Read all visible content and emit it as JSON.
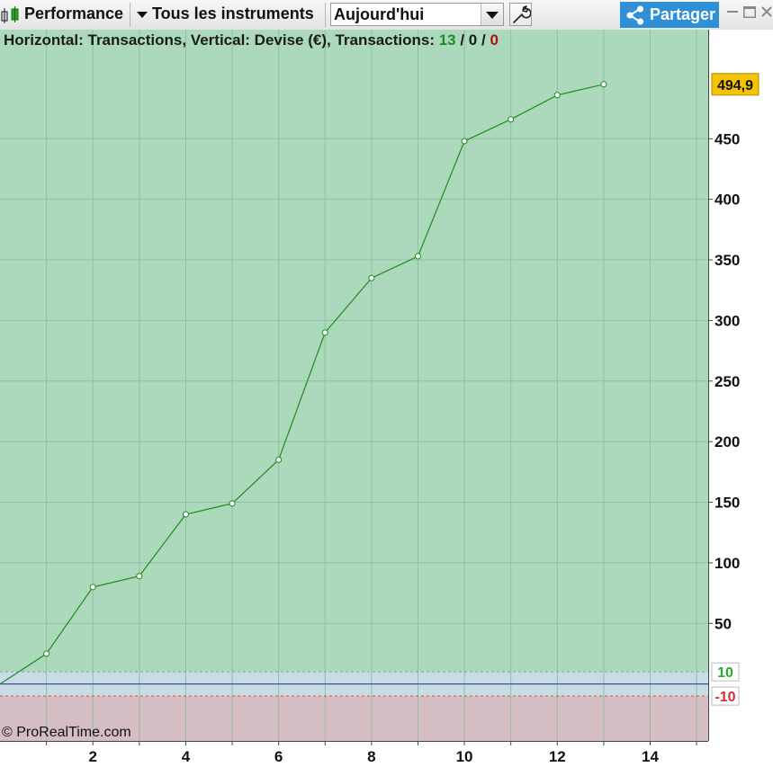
{
  "toolbar": {
    "app_label": "Performance",
    "instruments_label": "Tous les instruments",
    "period_value": "Aujourd'hui",
    "share_label": "Partager"
  },
  "chart_header": {
    "prefix": "Horizontal: Transactions, Vertical: Devise (€), Transactions: ",
    "wins": "13",
    "sep1": " / ",
    "neutral": "0",
    "sep2": " / ",
    "losses": "0"
  },
  "copyright": "© ProRealTime.com",
  "colors": {
    "profit_zone": "#acd9bb",
    "neutral_zone": "#c9dce6",
    "loss_zone": "#d4bdc3",
    "line": "#1e8c1e",
    "last_value_bg": "#f5c400",
    "upper_label": "#2ea82e",
    "lower_label": "#d23030"
  },
  "chart_data": {
    "type": "line",
    "title": "",
    "xlabel": "Transactions",
    "ylabel": "Devise (€)",
    "x": [
      0,
      1,
      2,
      3,
      4,
      5,
      6,
      7,
      8,
      9,
      10,
      11,
      12,
      13
    ],
    "series": [
      {
        "values": [
          0,
          25,
          80,
          89,
          140,
          149,
          185,
          290,
          335,
          353,
          448,
          466,
          486,
          494.9
        ]
      }
    ],
    "last_value_label": "494,9",
    "xticks": [
      2,
      4,
      6,
      8,
      10,
      12,
      14
    ],
    "yticks": [
      50,
      100,
      150,
      200,
      250,
      300,
      350,
      400,
      450
    ],
    "xlim": [
      0,
      15.25
    ],
    "ylim": [
      -47,
      540
    ],
    "threshold_upper": 10,
    "threshold_lower": -10,
    "threshold_upper_label": "10",
    "threshold_lower_label": "-10",
    "grid": true
  }
}
